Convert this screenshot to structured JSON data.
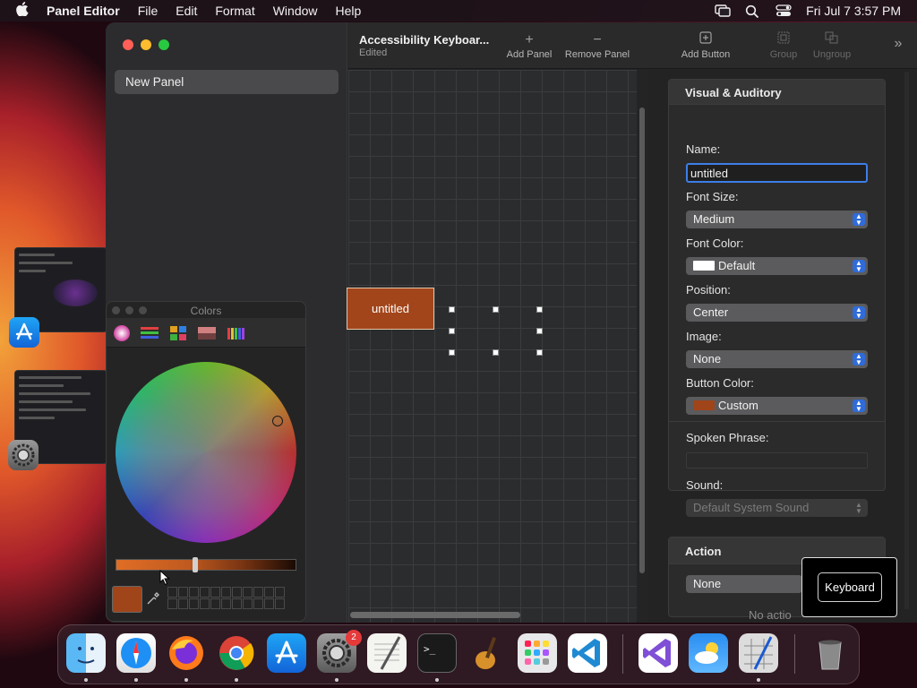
{
  "menubar": {
    "app_name": "Panel Editor",
    "menus": [
      "File",
      "Edit",
      "Format",
      "Window",
      "Help"
    ],
    "clock": "Fri Jul 7  3:57 PM"
  },
  "sidebar": {
    "items": [
      {
        "label": "New Panel"
      }
    ]
  },
  "toolbar": {
    "doc_title": "Accessibility Keyboar...",
    "doc_status": "Edited",
    "add_panel": "Add Panel",
    "remove_panel": "Remove Panel",
    "add_button": "Add Button",
    "group": "Group",
    "ungroup": "Ungroup"
  },
  "canvas": {
    "button_label": "untitled",
    "button_color": "#a2451a"
  },
  "inspector": {
    "visual_header": "Visual & Auditory",
    "name_label": "Name:",
    "name_value": "untitled",
    "font_size_label": "Font Size:",
    "font_size_value": "Medium",
    "font_color_label": "Font Color:",
    "font_color_value": "Default",
    "position_label": "Position:",
    "position_value": "Center",
    "image_label": "Image:",
    "image_value": "None",
    "button_color_label": "Button Color:",
    "button_color_value": "Custom",
    "spoken_phrase_label": "Spoken Phrase:",
    "spoken_phrase_value": "",
    "sound_label": "Sound:",
    "sound_value": "Default System Sound",
    "action_header": "Action",
    "action_value": "None",
    "no_action_text": "No actio"
  },
  "tooltip": {
    "label": "Keyboard"
  },
  "colors_panel": {
    "title": "Colors",
    "current_color": "#a0451a"
  },
  "dock": {
    "settings_badge": "2"
  }
}
